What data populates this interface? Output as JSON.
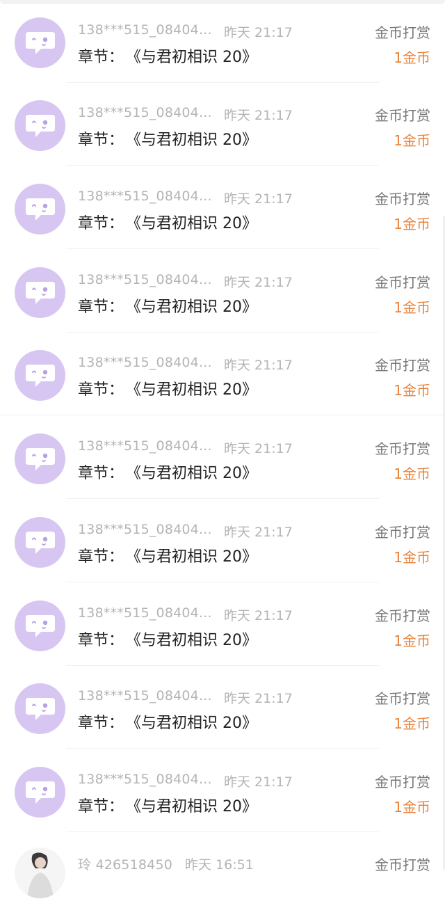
{
  "items": [
    {
      "user": "138***515_08404...",
      "time": "昨天 21:17",
      "chapter_label": "章节：",
      "chapter_title": "《与君初相识 20》",
      "type": "金币打赏",
      "amount": "1金币"
    },
    {
      "user": "138***515_08404...",
      "time": "昨天 21:17",
      "chapter_label": "章节：",
      "chapter_title": "《与君初相识 20》",
      "type": "金币打赏",
      "amount": "1金币"
    },
    {
      "user": "138***515_08404...",
      "time": "昨天 21:17",
      "chapter_label": "章节：",
      "chapter_title": "《与君初相识 20》",
      "type": "金币打赏",
      "amount": "1金币"
    },
    {
      "user": "138***515_08404...",
      "time": "昨天 21:17",
      "chapter_label": "章节：",
      "chapter_title": "《与君初相识 20》",
      "type": "金币打赏",
      "amount": "1金币"
    },
    {
      "user": "138***515_08404...",
      "time": "昨天 21:17",
      "chapter_label": "章节：",
      "chapter_title": "《与君初相识 20》",
      "type": "金币打赏",
      "amount": "1金币"
    },
    {
      "user": "138***515_08404...",
      "time": "昨天 21:17",
      "chapter_label": "章节：",
      "chapter_title": "《与君初相识 20》",
      "type": "金币打赏",
      "amount": "1金币"
    },
    {
      "user": "138***515_08404...",
      "time": "昨天 21:17",
      "chapter_label": "章节：",
      "chapter_title": "《与君初相识 20》",
      "type": "金币打赏",
      "amount": "1金币"
    },
    {
      "user": "138***515_08404...",
      "time": "昨天 21:17",
      "chapter_label": "章节：",
      "chapter_title": "《与君初相识 20》",
      "type": "金币打赏",
      "amount": "1金币"
    },
    {
      "user": "138***515_08404...",
      "time": "昨天 21:17",
      "chapter_label": "章节：",
      "chapter_title": "《与君初相识 20》",
      "type": "金币打赏",
      "amount": "1金币"
    },
    {
      "user": "138***515_08404...",
      "time": "昨天 21:17",
      "chapter_label": "章节：",
      "chapter_title": "《与君初相识 20》",
      "type": "金币打赏",
      "amount": "1金币"
    }
  ],
  "last_item": {
    "user": "玲 426518450",
    "time": "昨天 16:51",
    "type": "金币打赏"
  },
  "colors": {
    "avatar_bg": "#d8c6f2",
    "icon_fill": "#ffffff",
    "icon_accent": "#b9a0e6",
    "amount": "#e8833a",
    "meta": "#b4b4b4"
  },
  "icons": {
    "default_avatar": "chat-bubble-face-icon"
  }
}
